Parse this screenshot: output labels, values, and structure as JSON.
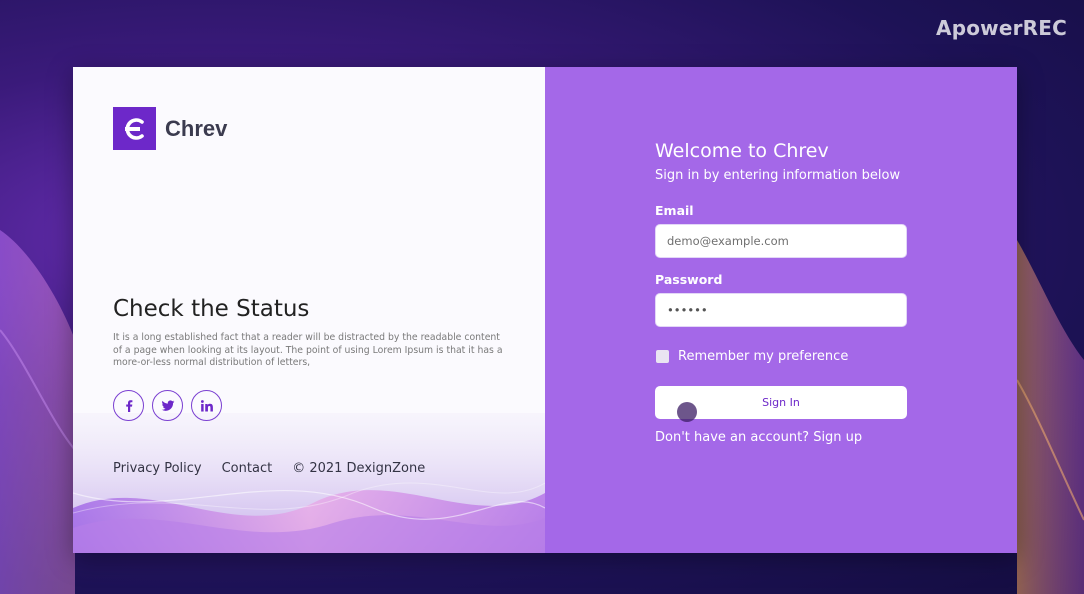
{
  "watermark": "ApowerREC",
  "brand": {
    "name": "Chrev",
    "logo_letter": "C",
    "accent_color": "#6d28c9"
  },
  "left": {
    "title": "Check the Status",
    "description": "It is a long established fact that a reader will be distracted by the readable content of a page when looking at its layout. The point of using Lorem Ipsum is that it has a more-or-less normal distribution of letters,",
    "socials": [
      {
        "icon": "facebook-icon",
        "glyph": "f"
      },
      {
        "icon": "twitter-icon",
        "glyph": "twitter-bird"
      },
      {
        "icon": "linkedin-icon",
        "glyph": "in"
      }
    ],
    "footer": {
      "privacy": "Privacy Policy",
      "contact": "Contact",
      "copyright": "© 2021 DexignZone"
    }
  },
  "form": {
    "heading": "Welcome to Chrev",
    "subtitle": "Sign in by entering information below",
    "email_label": "Email",
    "email_placeholder": "demo@example.com",
    "password_label": "Password",
    "password_value": "••••••",
    "remember_label": "Remember my preference",
    "remember_checked": false,
    "submit_label": "Sign In",
    "signup_text": "Don't have an account? Sign up",
    "panel_color": "#a468e8"
  }
}
